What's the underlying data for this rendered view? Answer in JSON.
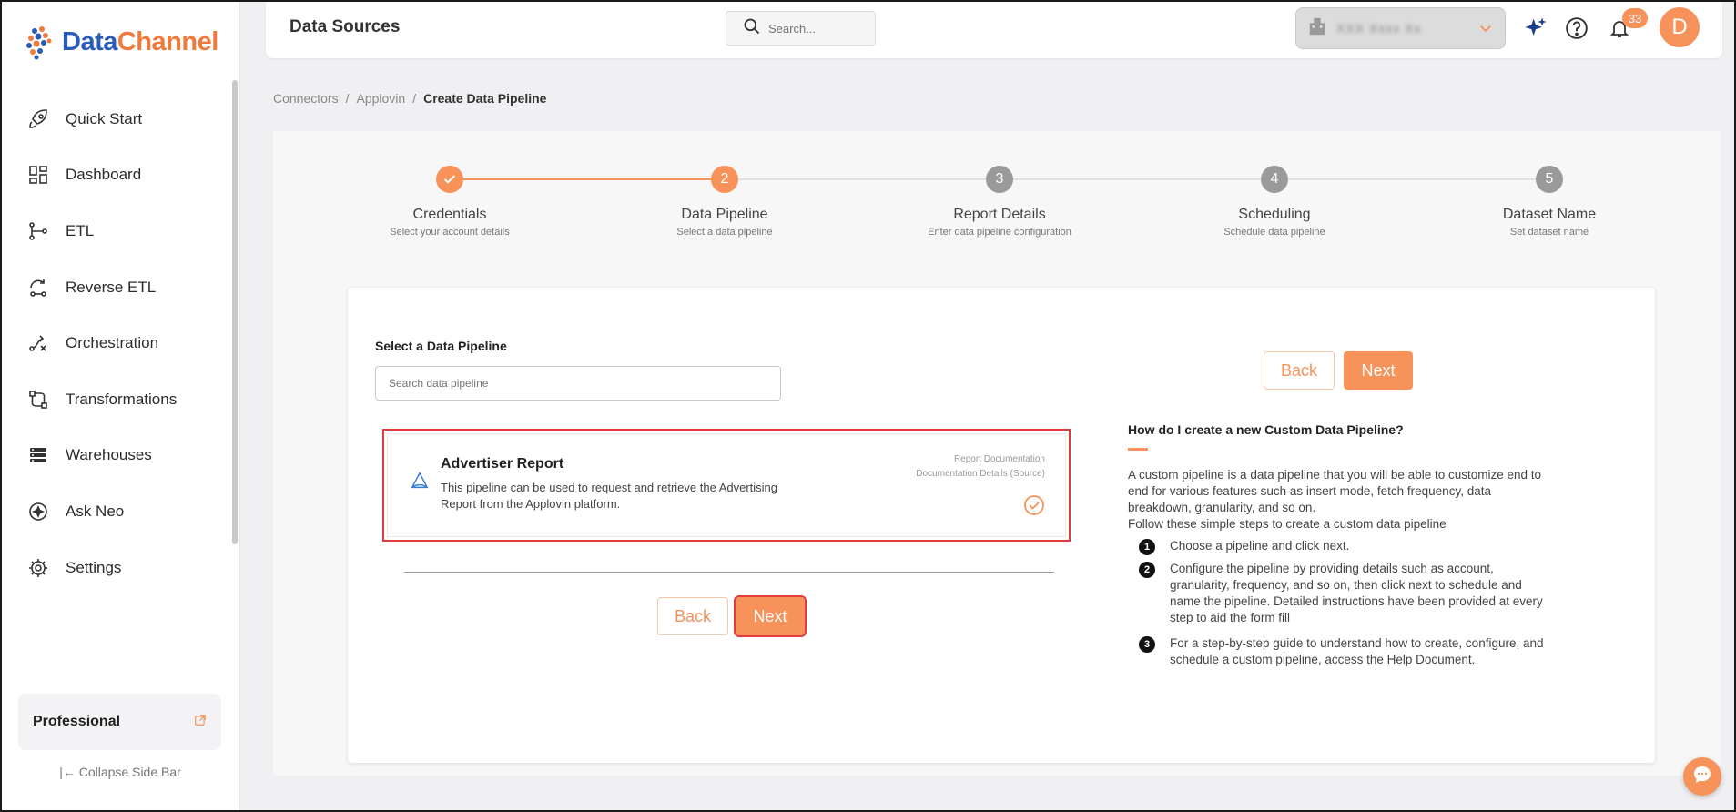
{
  "brand": {
    "name_part1": "Data",
    "name_part2": "Channel"
  },
  "sidebar": {
    "items": [
      {
        "label": "Quick Start",
        "icon": "rocket-icon"
      },
      {
        "label": "Dashboard",
        "icon": "dashboard-icon"
      },
      {
        "label": "ETL",
        "icon": "etl-icon"
      },
      {
        "label": "Reverse ETL",
        "icon": "reverse-etl-icon"
      },
      {
        "label": "Orchestration",
        "icon": "orchestration-icon"
      },
      {
        "label": "Transformations",
        "icon": "transformations-icon"
      },
      {
        "label": "Warehouses",
        "icon": "warehouses-icon"
      },
      {
        "label": "Ask Neo",
        "icon": "ask-neo-icon"
      },
      {
        "label": "Settings",
        "icon": "gear-icon"
      }
    ],
    "plan_label": "Professional",
    "collapse_label": "Collapse Side Bar"
  },
  "header": {
    "title": "Data Sources",
    "search_placeholder": "Search...",
    "account_value": "XXX Xxxx Xx",
    "notification_count": "33",
    "avatar_letter": "D"
  },
  "breadcrumb": {
    "items": [
      "Connectors",
      "Applovin"
    ],
    "current": "Create Data Pipeline"
  },
  "stepper": {
    "steps": [
      {
        "number": "✓",
        "title": "Credentials",
        "subtitle": "Select your account details",
        "state": "done"
      },
      {
        "number": "2",
        "title": "Data Pipeline",
        "subtitle": "Select a data pipeline",
        "state": "active"
      },
      {
        "number": "3",
        "title": "Report Details",
        "subtitle": "Enter data pipeline configuration",
        "state": "pending"
      },
      {
        "number": "4",
        "title": "Scheduling",
        "subtitle": "Schedule data pipeline",
        "state": "pending"
      },
      {
        "number": "5",
        "title": "Dataset Name",
        "subtitle": "Set dataset name",
        "state": "pending"
      }
    ]
  },
  "form": {
    "select_label": "Select a Data Pipeline",
    "search_placeholder": "Search data pipeline",
    "back_label": "Back",
    "next_label": "Next"
  },
  "pipeline": {
    "title": "Advertiser Report",
    "description": "This pipeline can be used to request and retrieve the Advertising Report from the Applovin platform.",
    "link_report_docs": "Report Documentation",
    "link_doc_details": "Documentation Details (Source)"
  },
  "help": {
    "title": "How do I create a new Custom Data Pipeline?",
    "intro": "A custom pipeline is a data pipeline that you will be able to customize end to end for various features such as insert mode, fetch frequency, data breakdown, granularity, and so on.",
    "follow": "Follow these simple steps to create a custom data pipeline",
    "steps": [
      {
        "n": "1",
        "text": "Choose a pipeline and click next."
      },
      {
        "n": "2",
        "text": "Configure the pipeline by providing details such as account, granularity, frequency, and so on, then click next to schedule and name the pipeline. Detailed instructions have been provided at every step to aid the form fill"
      },
      {
        "n": "3",
        "text": "For a step-by-step guide to understand how to create, configure, and schedule a custom pipeline, access the Help Document."
      }
    ]
  },
  "colors": {
    "accent": "#f7935a",
    "brand_blue": "#2b5bb8",
    "highlight": "#e23b3b"
  }
}
